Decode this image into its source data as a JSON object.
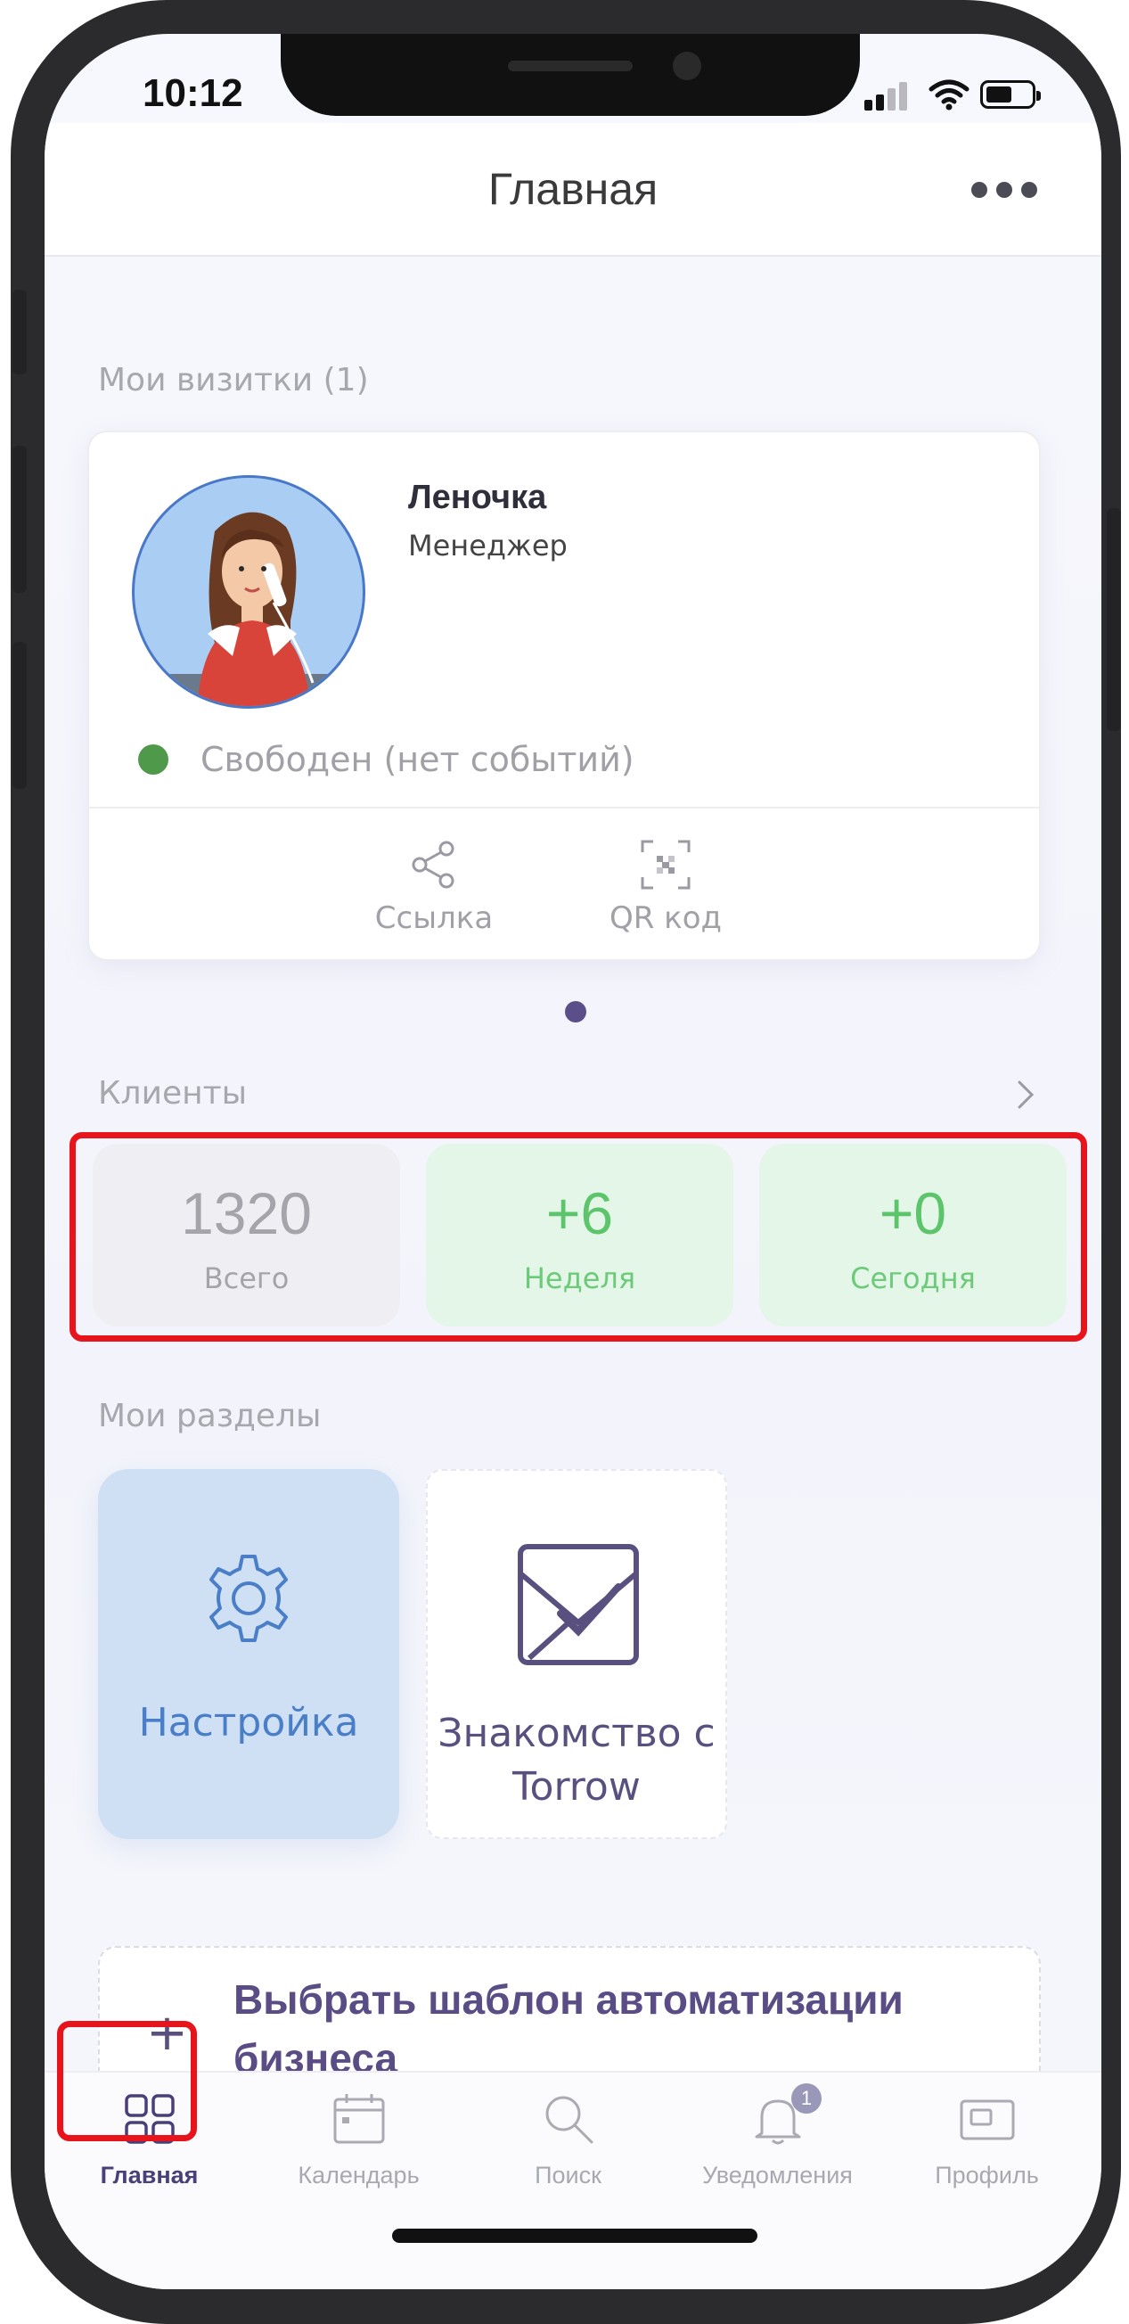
{
  "status_bar": {
    "time": "10:12"
  },
  "header": {
    "title": "Главная"
  },
  "cards_section": {
    "label": "Мои визитки (1)"
  },
  "business_card": {
    "name": "Леночка",
    "role": "Менеджер",
    "status": "Свободен (нет событий)",
    "status_color": "#4f9a4a",
    "actions": [
      {
        "label": "Ссылка",
        "icon": "share-icon"
      },
      {
        "label": "QR код",
        "icon": "qr-code-icon"
      }
    ]
  },
  "clients": {
    "label": "Клиенты",
    "stats": [
      {
        "value": "1320",
        "caption": "Всего"
      },
      {
        "value": "+6",
        "caption": "Неделя"
      },
      {
        "value": "+0",
        "caption": "Сегодня"
      }
    ]
  },
  "sections": {
    "label": "Мои разделы",
    "tiles": [
      {
        "label": "Настройка",
        "icon": "gear-icon"
      },
      {
        "label": "Знакомство с Torrow",
        "icon": "envelope-check-icon"
      }
    ]
  },
  "template": {
    "plus": "+",
    "text": "Выбрать шаблон автоматизации бизнеса"
  },
  "tabbar": {
    "items": [
      {
        "label": "Главная",
        "icon": "grid-icon",
        "active": true
      },
      {
        "label": "Календарь",
        "icon": "calendar-icon"
      },
      {
        "label": "Поиск",
        "icon": "search-icon"
      },
      {
        "label": "Уведомления",
        "icon": "bell-icon",
        "badge": "1"
      },
      {
        "label": "Профиль",
        "icon": "profile-card-icon"
      }
    ]
  },
  "colors": {
    "accent": "#5a4d85",
    "positive": "#5cc46a",
    "highlight": "#e8141c"
  }
}
